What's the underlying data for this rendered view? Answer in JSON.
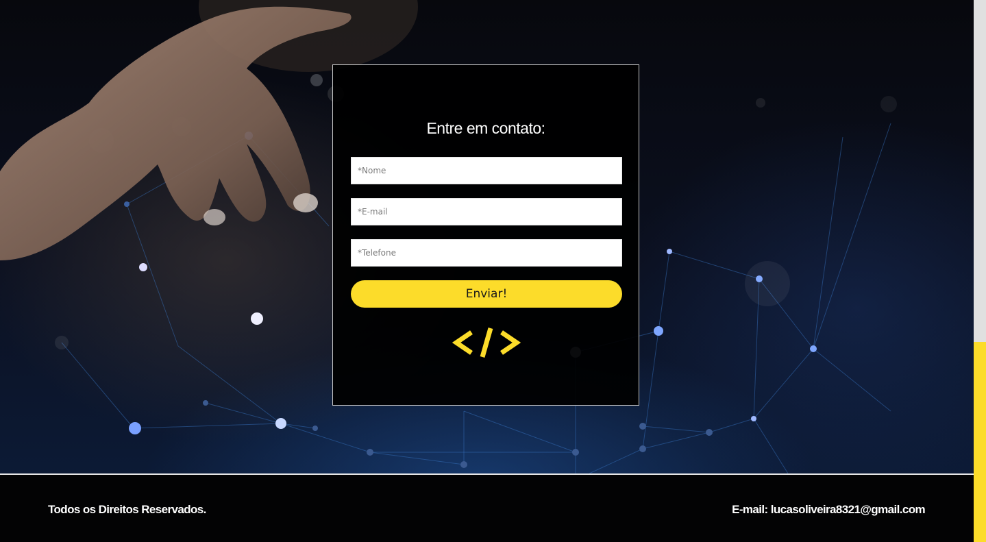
{
  "form": {
    "title": "Entre em contato:",
    "name_placeholder": "*Nome",
    "email_placeholder": "*E-mail",
    "phone_placeholder": "*Telefone",
    "submit_label": "Enviar!",
    "logo_glyph": "code-brackets-icon"
  },
  "footer": {
    "rights_text": "Todos os Direitos Reservados.",
    "email_text": "E-mail: lucasoliveira8321@gmail.com"
  },
  "colors": {
    "accent": "#fcdc2a",
    "background": "#000000",
    "text": "#ffffff"
  }
}
